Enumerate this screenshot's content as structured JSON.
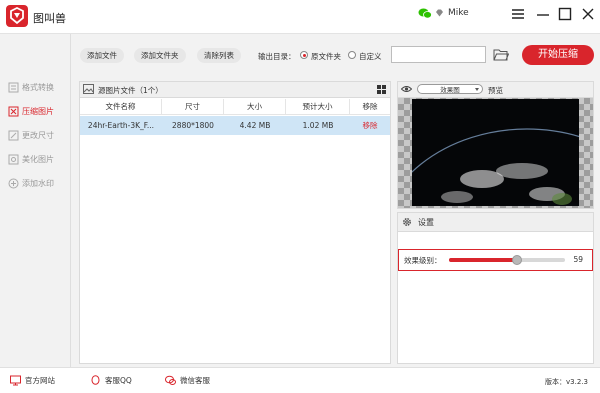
{
  "app": {
    "title": "图叫兽",
    "username": "Mike"
  },
  "sidebar": {
    "items": [
      {
        "label": "格式转换",
        "icon": "format-convert-icon",
        "active": false
      },
      {
        "label": "压缩图片",
        "icon": "compress-icon",
        "active": true
      },
      {
        "label": "更改尺寸",
        "icon": "resize-icon",
        "active": false
      },
      {
        "label": "美化图片",
        "icon": "beautify-icon",
        "active": false
      },
      {
        "label": "添加水印",
        "icon": "watermark-icon",
        "active": false
      }
    ]
  },
  "toolbar": {
    "add_file": "添加文件",
    "add_folder": "添加文件夹",
    "clear_list": "清除列表",
    "output_label": "输出目录：",
    "option_source": "原文件夹",
    "option_custom": "自定义",
    "output_path": "",
    "start": "开始压缩"
  },
  "file_panel": {
    "title": "源图片文件（1个）",
    "columns": [
      "文件名称",
      "尺寸",
      "大小",
      "预计大小",
      "移除"
    ],
    "rows": [
      {
        "name": "24hr-Earth-3K_F...",
        "dims": "2880*1800",
        "size": "4.42 MB",
        "est_size": "1.02 MB",
        "remove": "移除"
      }
    ]
  },
  "preview": {
    "mode": "效果图",
    "label": "预览"
  },
  "settings": {
    "title": "设置",
    "level_label": "效果级别：",
    "level_value": "59",
    "level_fraction": 0.59
  },
  "footer": {
    "website": "官方网站",
    "qq": "客服QQ",
    "wechat": "微信客服",
    "version": "版本：v3.2.3"
  },
  "colors": {
    "accent": "#d9252c",
    "selected_row": "#cfe5f6",
    "wechat_green": "#2dc100"
  }
}
